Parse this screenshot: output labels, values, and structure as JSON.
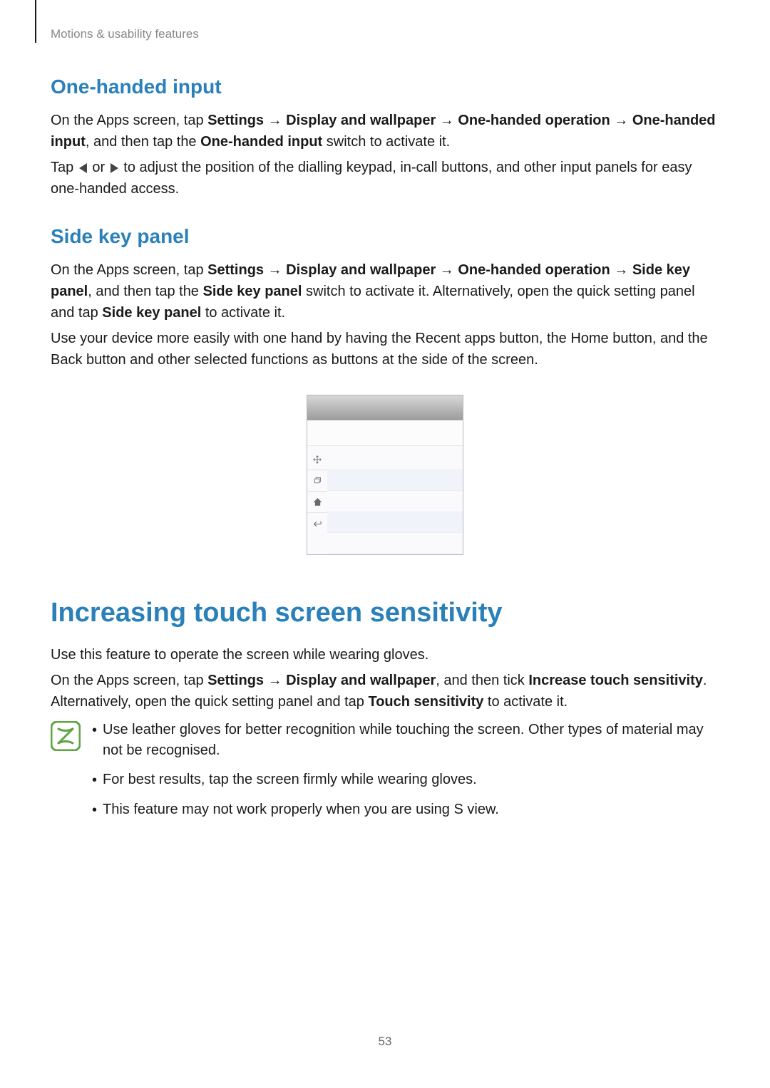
{
  "breadcrumb": "Motions & usability features",
  "sections": {
    "one_handed": {
      "title": "One-handed input",
      "p1_a": "On the Apps screen, tap ",
      "p1_b": "Settings",
      "p1_c": " → ",
      "p1_d": "Display and wallpaper",
      "p1_e": " → ",
      "p1_f": "One-handed operation",
      "p1_g": " → ",
      "p1_h": "One-handed input",
      "p1_i": ", and then tap the ",
      "p1_j": "One-handed input",
      "p1_k": " switch to activate it.",
      "p2_a": "Tap ",
      "p2_b": " or ",
      "p2_c": " to adjust the position of the dialling keypad, in-call buttons, and other input panels for easy one-handed access."
    },
    "side_key": {
      "title": "Side key panel",
      "p1_a": "On the Apps screen, tap ",
      "p1_b": "Settings",
      "p1_c": " → ",
      "p1_d": "Display and wallpaper",
      "p1_e": " → ",
      "p1_f": "One-handed operation",
      "p1_g": " → ",
      "p1_h": "Side key panel",
      "p1_i": ", and then tap the ",
      "p1_j": "Side key panel",
      "p1_k": " switch to activate it. Alternatively, open the quick setting panel and tap ",
      "p1_l": "Side key panel",
      "p1_m": " to activate it.",
      "p2": "Use your device more easily with one hand by having the Recent apps button, the Home button, and the Back button and other selected functions as buttons at the side of the screen."
    },
    "touch": {
      "title": "Increasing touch screen sensitivity",
      "p1": "Use this feature to operate the screen while wearing gloves.",
      "p2_a": "On the Apps screen, tap ",
      "p2_b": "Settings",
      "p2_c": " → ",
      "p2_d": "Display and wallpaper",
      "p2_e": ", and then tick ",
      "p2_f": "Increase touch sensitivity",
      "p2_g": ". Alternatively, open the quick setting panel and tap ",
      "p2_h": "Touch sensitivity",
      "p2_i": " to activate it.",
      "bullets": {
        "b1": "Use leather gloves for better recognition while touching the screen. Other types of material may not be recognised.",
        "b2": "For best results, tap the screen firmly while wearing gloves.",
        "b3": "This feature may not work properly when you are using S view."
      }
    }
  },
  "icons": {
    "move": "move-icon",
    "recent": "recent-apps-icon",
    "home": "home-icon",
    "back": "back-icon"
  },
  "page_number": "53"
}
